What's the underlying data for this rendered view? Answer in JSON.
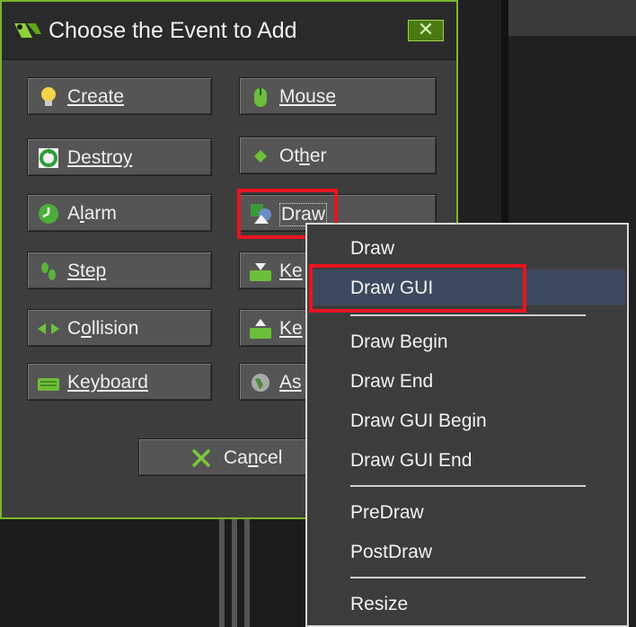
{
  "dialog": {
    "title": "Choose the Event to Add",
    "close_symbol": "✕"
  },
  "events_left": [
    {
      "label": "Create",
      "icon": "lightbulb-icon"
    },
    {
      "label": "Destroy",
      "icon": "recycle-icon"
    },
    {
      "label": "Alarm",
      "icon": "clock-icon"
    },
    {
      "label": "Step",
      "icon": "footsteps-icon"
    },
    {
      "label": "Collision",
      "icon": "collision-arrows-icon"
    },
    {
      "label": "Keyboard",
      "icon": "keyboard-icon"
    }
  ],
  "events_right": [
    {
      "label": "Mouse",
      "icon": "mouse-icon"
    },
    {
      "label": "Other",
      "icon": "diamond-icon"
    },
    {
      "label": "Draw",
      "icon": "draw-shapes-icon"
    },
    {
      "label": "Ke",
      "icon": "key-press-icon"
    },
    {
      "label": "Ke",
      "icon": "key-release-icon"
    },
    {
      "label": "As",
      "icon": "globe-icon"
    }
  ],
  "cancel_label": "Cancel",
  "draw_menu": {
    "group1": [
      "Draw",
      "Draw GUI"
    ],
    "group2": [
      "Draw Begin",
      "Draw End",
      "Draw GUI Begin",
      "Draw GUI End"
    ],
    "group3": [
      "PreDraw",
      "PostDraw"
    ],
    "group4": [
      "Resize"
    ],
    "highlighted": "Draw GUI"
  },
  "colors": {
    "accent": "#76b82a",
    "highlight_box": "#e8141e",
    "menu_hover": "#3c4a5e"
  }
}
